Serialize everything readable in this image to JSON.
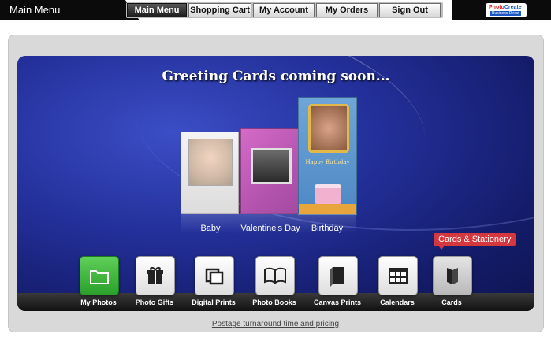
{
  "header": {
    "title": "Main Menu",
    "nav": [
      {
        "label": "Main Menu",
        "active": true
      },
      {
        "label": "Shopping Cart",
        "active": false
      },
      {
        "label": "My Account",
        "active": false
      },
      {
        "label": "My Orders",
        "active": false
      },
      {
        "label": "Sign Out",
        "active": false
      }
    ],
    "logo": {
      "line1": "Photo",
      "line1b": "Create",
      "line2": "Business Direct"
    }
  },
  "banner": {
    "headline": "Greeting Cards coming soon...",
    "cards": [
      {
        "label": "Baby"
      },
      {
        "label": "Valentine's Day"
      },
      {
        "label": "Birthday",
        "inner_text": "Happy Birthday"
      }
    ]
  },
  "tooltip": "Cards & Stationery",
  "products": [
    {
      "label": "My Photos",
      "icon": "folder-icon",
      "state": "selected"
    },
    {
      "label": "Photo Gifts",
      "icon": "gift-icon"
    },
    {
      "label": "Digital Prints",
      "icon": "prints-icon"
    },
    {
      "label": "Photo Books",
      "icon": "book-icon"
    },
    {
      "label": "Canvas Prints",
      "icon": "canvas-icon"
    },
    {
      "label": "Calendars",
      "icon": "calendar-icon"
    },
    {
      "label": "Cards",
      "icon": "card-icon",
      "state": "hover"
    }
  ],
  "footer": {
    "link": "Postage turnaround time and pricing"
  },
  "colors": {
    "accent_green": "#2aa02a",
    "tooltip_red": "#d5373f",
    "banner_blue": "#23309a"
  }
}
